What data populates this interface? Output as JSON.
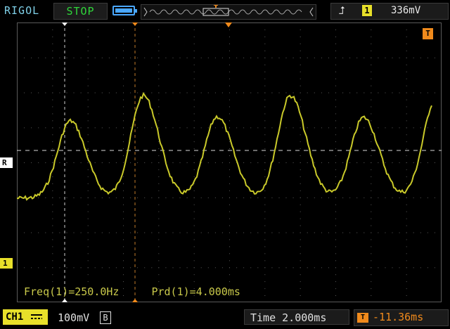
{
  "topbar": {
    "brand": "RIGOL",
    "run_state": "STOP",
    "trigger_channel": "1",
    "trigger_level": "336mV"
  },
  "markers": {
    "reference": "R",
    "channel": "1",
    "trigger_pos": "T"
  },
  "measurements": {
    "freq": "Freq(1)=250.0Hz",
    "period": "Prd(1)=4.000ms"
  },
  "bottombar": {
    "channel_label": "CH1",
    "ch1_scale": "100mV",
    "bandwidth_badge": "B",
    "timebase": "Time 2.000ms",
    "trigger_offset_icon": "T",
    "trigger_offset": "-11.36ms"
  },
  "colors": {
    "trace": "#c9c92a",
    "run_state": "#2fd63a",
    "trigger": "#f08a1c",
    "channel": "#e8e02a"
  },
  "icons": [
    "battery-icon",
    "rising-edge-icon",
    "trigger-offset-icon",
    "dc-coupling-icon"
  ]
}
